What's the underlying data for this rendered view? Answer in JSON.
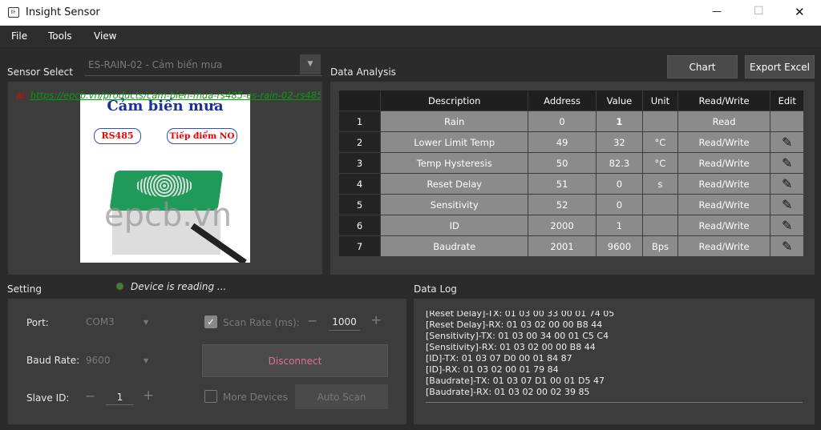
{
  "window": {
    "title": "Insight Sensor",
    "minimize": "—",
    "maximize": "☐",
    "close": "✕"
  },
  "menu": [
    "File",
    "Tools",
    "View"
  ],
  "sensor_select": {
    "label": "Sensor Select",
    "value": "ES-RAIN-02 - Cảm biến mưa",
    "link_prefix": "ại:",
    "link": "https://epcb.vn/products/cam-bien-mua-rs485-es-rain-02-rs485-",
    "image": {
      "title": "Cảm biến mưa",
      "badge1": "RS485",
      "badge2": "Tiếp điểm NO",
      "watermark": "epcb.vn"
    }
  },
  "data_analysis": {
    "label": "Data Analysis",
    "chart_button": "Chart",
    "export_button": "Export Excel",
    "columns": [
      "",
      "Description",
      "Address",
      "Value",
      "Unit",
      "Read/Write",
      "Edit"
    ],
    "rows": [
      {
        "n": "1",
        "desc": "Rain",
        "addr": "0",
        "value": "1",
        "unit": "",
        "rw": "Read",
        "edit": false
      },
      {
        "n": "2",
        "desc": "Lower Limit Temp",
        "addr": "49",
        "value": "32",
        "unit": "°C",
        "rw": "Read/Write",
        "edit": true
      },
      {
        "n": "3",
        "desc": "Temp Hysteresis",
        "addr": "50",
        "value": "82.3",
        "unit": "°C",
        "rw": "Read/Write",
        "edit": true
      },
      {
        "n": "4",
        "desc": "Reset Delay",
        "addr": "51",
        "value": "0",
        "unit": "s",
        "rw": "Read/Write",
        "edit": true
      },
      {
        "n": "5",
        "desc": "Sensitivity",
        "addr": "52",
        "value": "0",
        "unit": "",
        "rw": "Read/Write",
        "edit": true
      },
      {
        "n": "6",
        "desc": "ID",
        "addr": "2000",
        "value": "1",
        "unit": "",
        "rw": "Read/Write",
        "edit": true
      },
      {
        "n": "7",
        "desc": "Baudrate",
        "addr": "2001",
        "value": "9600",
        "unit": "Bps",
        "rw": "Read/Write",
        "edit": true
      }
    ]
  },
  "setting": {
    "label": "Setting",
    "status": "Device is reading ...",
    "status_color": "#4a7a3a",
    "port_label": "Port:",
    "port": "COM3",
    "baud_label": "Baud Rate:",
    "baud": "9600",
    "slave_label": "Slave ID:",
    "slave": "1",
    "scan_rate_label": "Scan Rate (ms):",
    "scan_rate": "1000",
    "scan_rate_checked": true,
    "disconnect": "Disconnect",
    "more_devices": "More Devices",
    "more_devices_checked": false,
    "auto_scan": "Auto Scan"
  },
  "data_log": {
    "label": "Data Log",
    "lines": [
      "[Reset Delay]-TX: 01 03 00 33 00 01 74 05",
      "[Reset Delay]-RX: 01 03 02 00 00 B8 44",
      "[Sensitivity]-TX: 01 03 00 34 00 01 C5 C4",
      "[Sensitivity]-RX: 01 03 02 00 00 B8 44",
      "[ID]-TX: 01 03 07 D0 00 01 84 87",
      "[ID]-RX: 01 03 02 00 01 79 84",
      "[Baudrate]-TX: 01 03 07 D1 00 01 D5 47",
      "[Baudrate]-RX: 01 03 02 00 02 39 85"
    ]
  }
}
